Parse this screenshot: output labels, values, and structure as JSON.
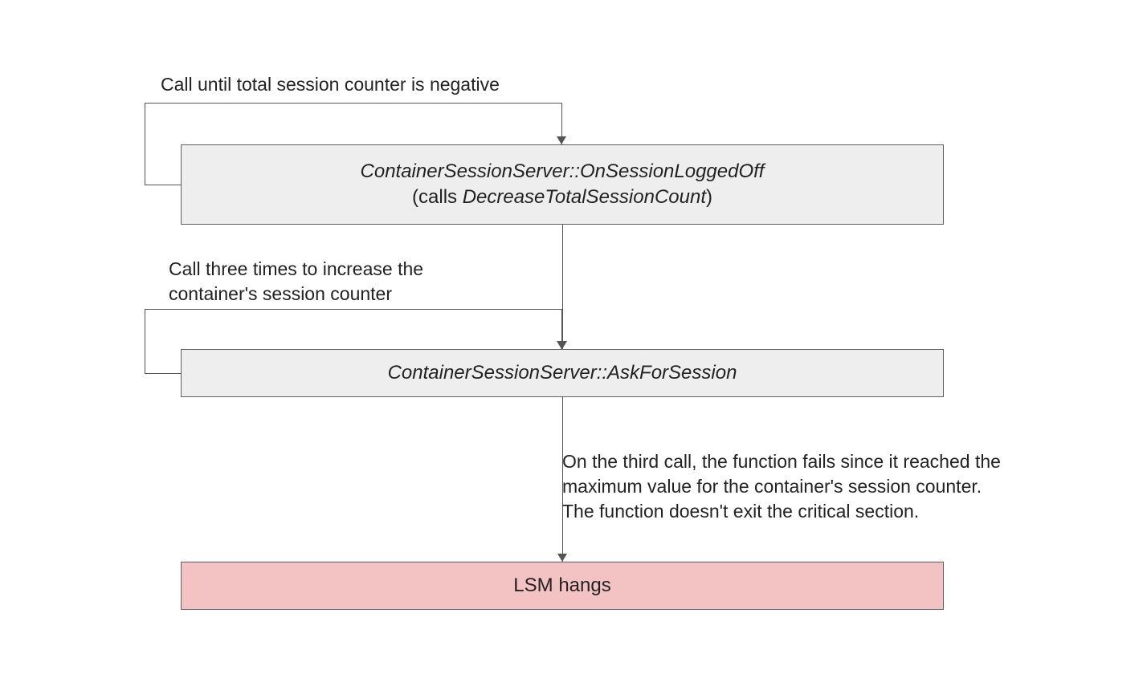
{
  "labels": {
    "top_loop": "Call until total session counter is negative",
    "mid_loop_line1": "Call three times to increase the",
    "mid_loop_line2": "container's session counter",
    "bottom_note_line1": "On the third call, the function fails since it reached the",
    "bottom_note_line2": "maximum value for the container's session counter.",
    "bottom_note_line3": "The function doesn't exit the critical section."
  },
  "nodes": {
    "a_line1": "ContainerSessionServer::OnSessionLoggedOff",
    "a_line2_prefix": "(calls ",
    "a_line2_italic": "DecreaseTotalSessionCount",
    "a_line2_suffix": ")",
    "b": "ContainerSessionServer::AskForSession",
    "c": "LSM hangs"
  }
}
